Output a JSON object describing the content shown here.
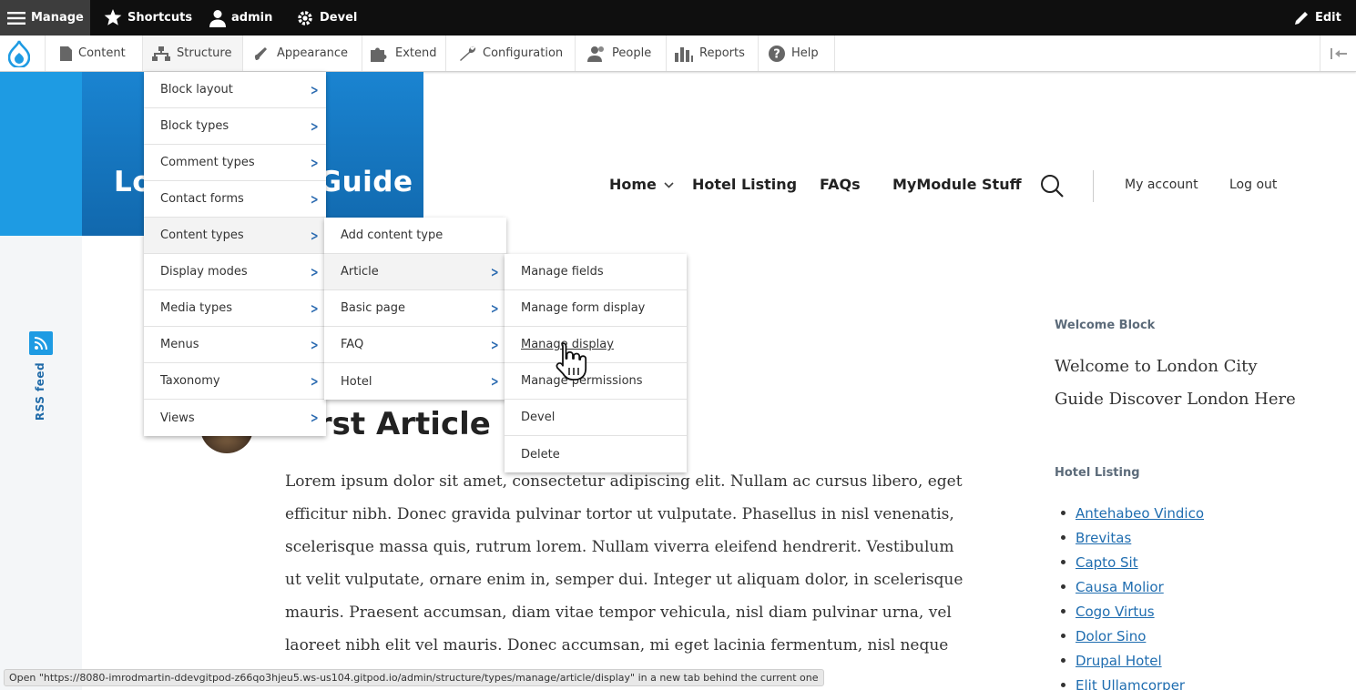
{
  "toolbar": {
    "manage": "Manage",
    "shortcuts": "Shortcuts",
    "user": "admin",
    "devel": "Devel",
    "edit": "Edit"
  },
  "tray": {
    "content": "Content",
    "structure": "Structure",
    "appearance": "Appearance",
    "extend": "Extend",
    "configuration": "Configuration",
    "people": "People",
    "reports": "Reports",
    "help": "Help"
  },
  "site": {
    "name": "London City Guide",
    "rss_label": "RSS feed"
  },
  "main_nav": {
    "home": "Home",
    "hotel_listing": "Hotel Listing",
    "faqs": "FAQs",
    "mymodule": "MyModule Stuff",
    "my_account": "My account",
    "log_out": "Log out"
  },
  "structure_menu": [
    "Block layout",
    "Block types",
    "Comment types",
    "Contact forms",
    "Content types",
    "Display modes",
    "Media types",
    "Menus",
    "Taxonomy",
    "Views"
  ],
  "content_types_menu": [
    "Add content type",
    "Article",
    "Basic page",
    "FAQ",
    "Hotel"
  ],
  "article_menu": [
    "Manage fields",
    "Manage form display",
    "Manage display",
    "Manage permissions",
    "Devel",
    "Delete"
  ],
  "article": {
    "title": "First Article",
    "body_lines": [
      "Lorem ipsum dolor sit amet, consectetur adipiscing elit. Nullam ac cursus libero, eget",
      "efficitur nibh. Donec gravida pulvinar tortor ut vulputate. Phasellus in nisl venenatis,",
      "scelerisque massa quis, rutrum lorem. Nullam viverra eleifend hendrerit. Vestibulum",
      "ut velit vulputate, ornare enim in, semper dui. Integer ut aliquam dolor, in scelerisque",
      "mauris. Praesent accumsan, diam vitae tempor vehicula, nisl diam pulvinar urna, vel",
      "laoreet nibh elit vel mauris. Donec accumsan, mi eget lacinia fermentum, nisl neque"
    ]
  },
  "sidebar": {
    "welcome_heading": "Welcome Block",
    "welcome_line1": "Welcome to London City",
    "welcome_line2": "Guide Discover London Here",
    "hotel_heading": "Hotel Listing",
    "hotels": [
      "Antehabeo Vindico",
      "Brevitas",
      "Capto Sit",
      "Causa Molior",
      "Cogo Virtus",
      "Dolor Sino",
      "Drupal Hotel",
      "Elit Ullamcorper"
    ]
  },
  "status_bar": "Open \"https://8080-imrodmartin-ddevgitpod-z66qo3hjeu5.ws-us104.gitpod.io/admin/structure/types/manage/article/display\" in a new tab behind the current one"
}
